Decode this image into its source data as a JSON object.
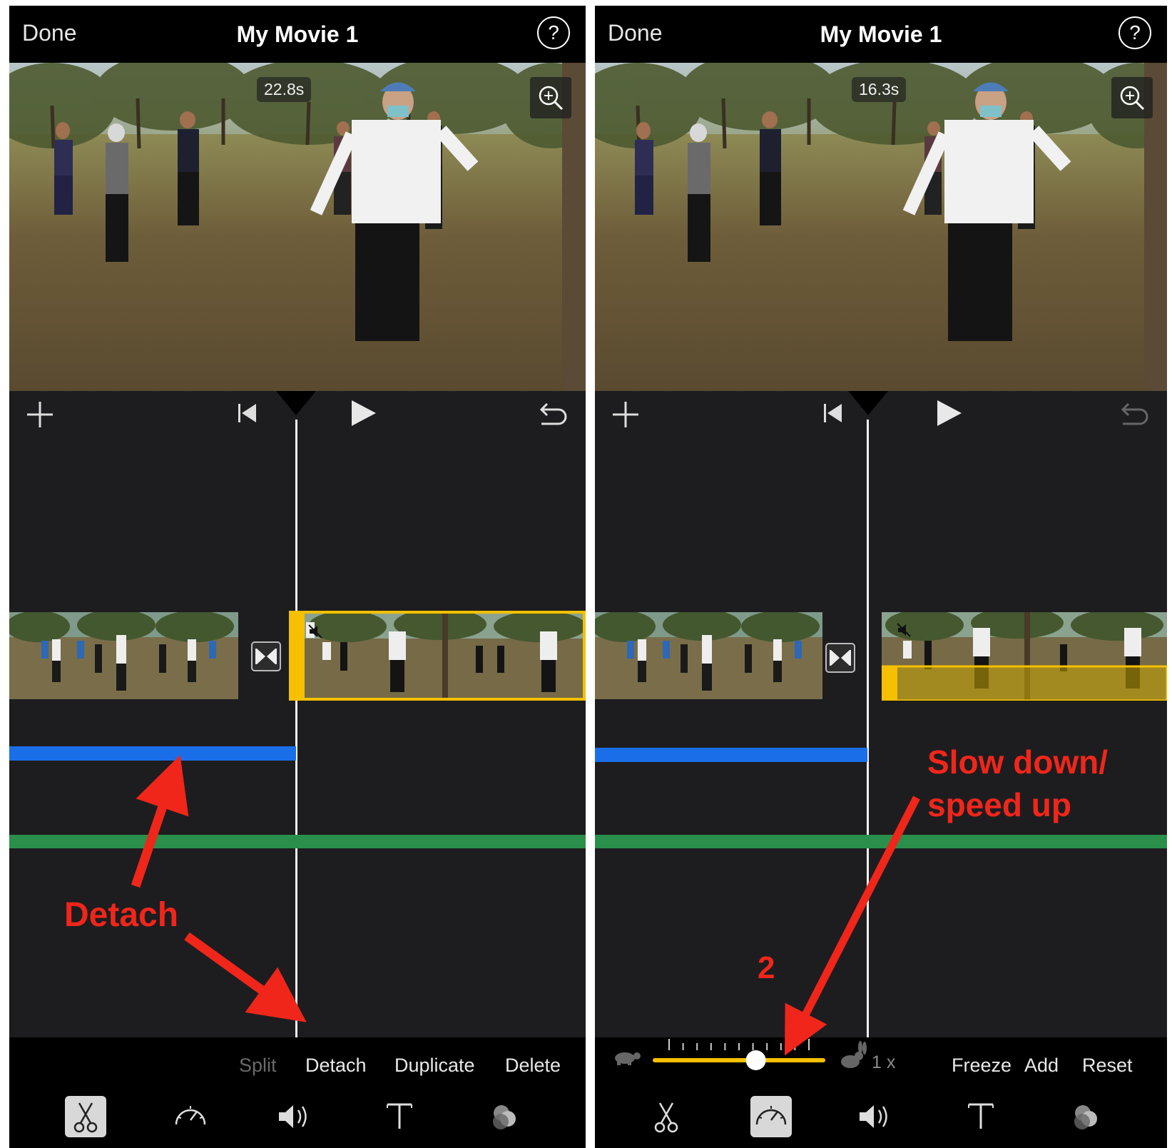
{
  "left": {
    "header": {
      "done_label": "Done",
      "title": "My Movie 1",
      "help_label": "?"
    },
    "preview": {
      "duration_badge": "22.8s"
    },
    "actions": {
      "split": "Split",
      "detach": "Detach",
      "duplicate": "Duplicate",
      "delete": "Delete"
    },
    "annotation": "Detach",
    "active_tool": "scissors-tool"
  },
  "right": {
    "header": {
      "done_label": "Done",
      "title": "My Movie 1",
      "help_label": "?"
    },
    "preview": {
      "duration_badge": "16.3s"
    },
    "speed": {
      "value_label": "1 x",
      "level": 0.6
    },
    "actions": {
      "freeze": "Freeze",
      "add": "Add",
      "reset": "Reset"
    },
    "annotation_line1": "Slow down/",
    "annotation_line2": "speed up",
    "step_number": "2",
    "active_tool": "speed-tool"
  },
  "colors": {
    "selection": "#f6c000",
    "audio_blue": "#1a6fe8",
    "audio_green": "#2a8f4a",
    "annotation": "#f0261b",
    "speed_slider": "#f6c000"
  },
  "icons": [
    "add-icon",
    "skip-to-start-icon",
    "play-icon",
    "undo-icon",
    "zoom-in-icon",
    "transition-icon",
    "mute-icon",
    "scissors-icon",
    "speed-gauge-icon",
    "volume-icon",
    "text-icon",
    "filters-icon",
    "turtle-icon",
    "rabbit-icon"
  ]
}
